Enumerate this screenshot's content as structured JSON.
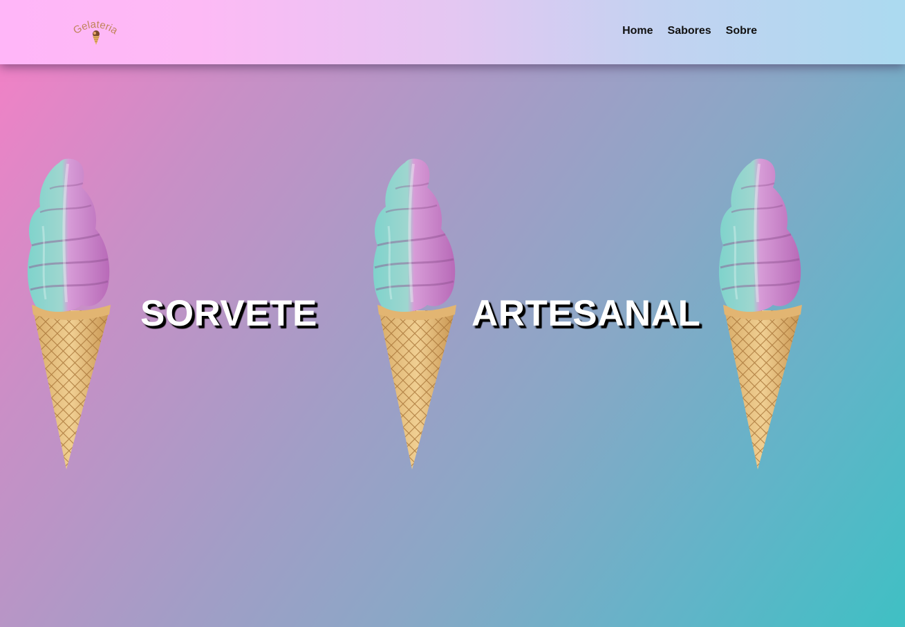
{
  "brand": {
    "logo_text": "Gelateria",
    "logo_icon": "ice-cream-icon"
  },
  "nav": {
    "items": [
      {
        "label": "Home"
      },
      {
        "label": "Sabores"
      },
      {
        "label": "Sobre"
      }
    ]
  },
  "hero": {
    "word_left": "SORVETE",
    "word_right": "ARTESANAL",
    "image_subject": "soft-serve ice cream cone (teal and pink swirl)"
  },
  "colors": {
    "navbar_gradient_start": "#ffb6f8",
    "navbar_gradient_end": "#abdaf0",
    "hero_gradient_start": "#f77fc6",
    "hero_gradient_end": "#3fc0c4",
    "logo_text": "#c0845a",
    "headline": "#ffffff"
  }
}
